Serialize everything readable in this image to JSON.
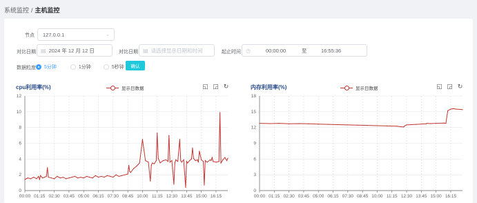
{
  "breadcrumb": {
    "parent": "系统监控",
    "separator": "/",
    "current": "主机监控"
  },
  "form": {
    "node_label": "节点",
    "node_value": "127.0.0.1",
    "compare_date_label": "对比日期",
    "compare_date_value": "2024 年 12 月 12 日",
    "compare_date2_label": "对比日期",
    "compare_date2_placeholder": "请选择显示日期和时间",
    "time_range_label": "起止时间",
    "time_start": "00:00:00",
    "time_to": "至",
    "time_end": "16:55:36",
    "granularity_label": "数据粒度",
    "granularity_options": [
      "5分钟",
      "1分钟",
      "5秒钟"
    ],
    "granularity_selected": "5分钟",
    "confirm_label": "确认"
  },
  "colors": {
    "series": "#c23531",
    "accent": "#409eff",
    "button": "#1fc8db",
    "title": "#2b4d8c"
  },
  "chart_data": [
    {
      "type": "line",
      "title": "cpu利用率(%)",
      "legend": [
        "显示日数据"
      ],
      "legend_position": "top",
      "toolbox": [
        "zoom-icon",
        "zoom-reset-icon",
        "restore-icon"
      ],
      "ylim": [
        0,
        12
      ],
      "yticks": [
        0,
        2,
        4,
        6,
        8,
        10,
        12
      ],
      "xlim": [
        0,
        1035
      ],
      "xticks": [
        "00:00",
        "01:15",
        "02:30",
        "03:45",
        "05:00",
        "06:15",
        "07:30",
        "08:45",
        "10:00",
        "11:15",
        "12:30",
        "13:45",
        "15:00",
        "16:15"
      ],
      "grid": true,
      "x": [
        0,
        15,
        30,
        45,
        60,
        70,
        75,
        80,
        90,
        100,
        110,
        115,
        120,
        135,
        150,
        165,
        180,
        195,
        210,
        225,
        240,
        255,
        270,
        285,
        300,
        315,
        330,
        345,
        360,
        375,
        390,
        405,
        420,
        435,
        450,
        465,
        480,
        495,
        510,
        525,
        530,
        535,
        540,
        555,
        570,
        585,
        600,
        615,
        630,
        640,
        645,
        650,
        660,
        670,
        675,
        680,
        690,
        705,
        720,
        730,
        735,
        740,
        750,
        760,
        765,
        770,
        780,
        790,
        795,
        800,
        810,
        820,
        825,
        830,
        840,
        850,
        855,
        860,
        870,
        880,
        885,
        890,
        900,
        910,
        915,
        920,
        930,
        945,
        950,
        955,
        960,
        975,
        990,
        995,
        1000,
        1010,
        1020,
        1030,
        1035
      ],
      "values": [
        1.4,
        1.6,
        1.5,
        1.7,
        1.5,
        1.8,
        1.4,
        1.9,
        1.6,
        1.7,
        1.8,
        2.9,
        1.7,
        1.6,
        1.5,
        1.8,
        1.6,
        1.7,
        1.5,
        1.6,
        1.7,
        1.8,
        1.6,
        1.7,
        1.6,
        1.8,
        1.7,
        1.6,
        1.9,
        1.7,
        1.8,
        1.7,
        1.9,
        1.8,
        1.7,
        2.0,
        1.8,
        1.9,
        2.0,
        2.1,
        3.2,
        2.4,
        2.3,
        2.8,
        3.1,
        3.5,
        6.5,
        3.8,
        3.6,
        1.2,
        3.2,
        3.5,
        3.4,
        3.8,
        7.3,
        4.1,
        3.5,
        3.8,
        3.9,
        3.7,
        7.0,
        3.6,
        3.8,
        0.8,
        3.5,
        3.9,
        3.7,
        6.5,
        3.8,
        3.6,
        3.9,
        0.4,
        3.7,
        3.5,
        3.8,
        4.0,
        5.4,
        4.1,
        3.8,
        3.9,
        3.6,
        5.0,
        3.9,
        3.7,
        0.7,
        3.8,
        3.6,
        3.9,
        3.8,
        4.2,
        3.7,
        3.6,
        3.7,
        9.9,
        3.5,
        3.9,
        4.2,
        3.8,
        4.1
      ]
    },
    {
      "type": "line",
      "title": "内存利用率(%)",
      "legend": [
        "显示日数据"
      ],
      "legend_position": "top",
      "toolbox": [
        "zoom-icon",
        "zoom-reset-icon",
        "restore-icon"
      ],
      "ylim": [
        0,
        18
      ],
      "yticks": [
        0,
        3,
        6,
        9,
        12,
        15,
        18
      ],
      "xlim": [
        0,
        1035
      ],
      "xticks": [
        "00:00",
        "01:15",
        "02:30",
        "03:45",
        "05:00",
        "06:15",
        "07:30",
        "08:45",
        "10:00",
        "11:15",
        "12:30",
        "13:45",
        "15:00",
        "16:15"
      ],
      "grid": true,
      "x": [
        0,
        50,
        100,
        150,
        200,
        250,
        300,
        350,
        400,
        450,
        500,
        550,
        600,
        650,
        700,
        720,
        735,
        740,
        750,
        800,
        850,
        855,
        870,
        900,
        940,
        950,
        960,
        975,
        990,
        1000,
        1035
      ],
      "values": [
        12.8,
        12.75,
        12.8,
        12.7,
        12.75,
        12.7,
        12.65,
        12.6,
        12.55,
        12.5,
        12.45,
        12.4,
        12.35,
        12.3,
        12.25,
        12.15,
        12.1,
        12.3,
        12.5,
        12.6,
        12.7,
        12.8,
        12.75,
        12.8,
        12.85,
        12.8,
        15.2,
        15.5,
        15.6,
        15.5,
        15.4
      ]
    }
  ]
}
